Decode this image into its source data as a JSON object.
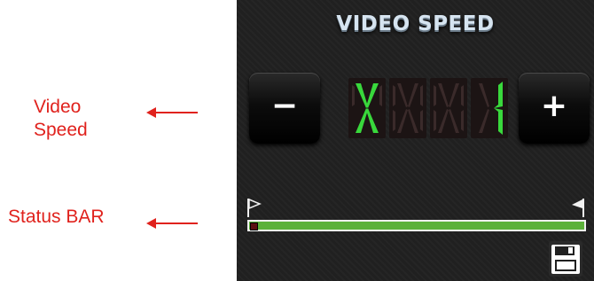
{
  "annotations": {
    "video_speed_line1": "Video",
    "video_speed_line2": "Speed",
    "status_bar": "Status BAR"
  },
  "panel": {
    "title": "VIDEO SPEED",
    "minus_label": "−",
    "plus_label": "+",
    "display_value": "X  1"
  },
  "status_bar": {
    "progress": 0.0,
    "start_icon": "start-flag-icon",
    "end_icon": "end-flag-icon"
  },
  "icons": {
    "save": "floppy-disk-icon"
  },
  "colors": {
    "annotation": "#e0221d",
    "segment_on": "#39d83c",
    "segment_off": "#3a2a2a",
    "bar_fill": "#5cb13a"
  }
}
